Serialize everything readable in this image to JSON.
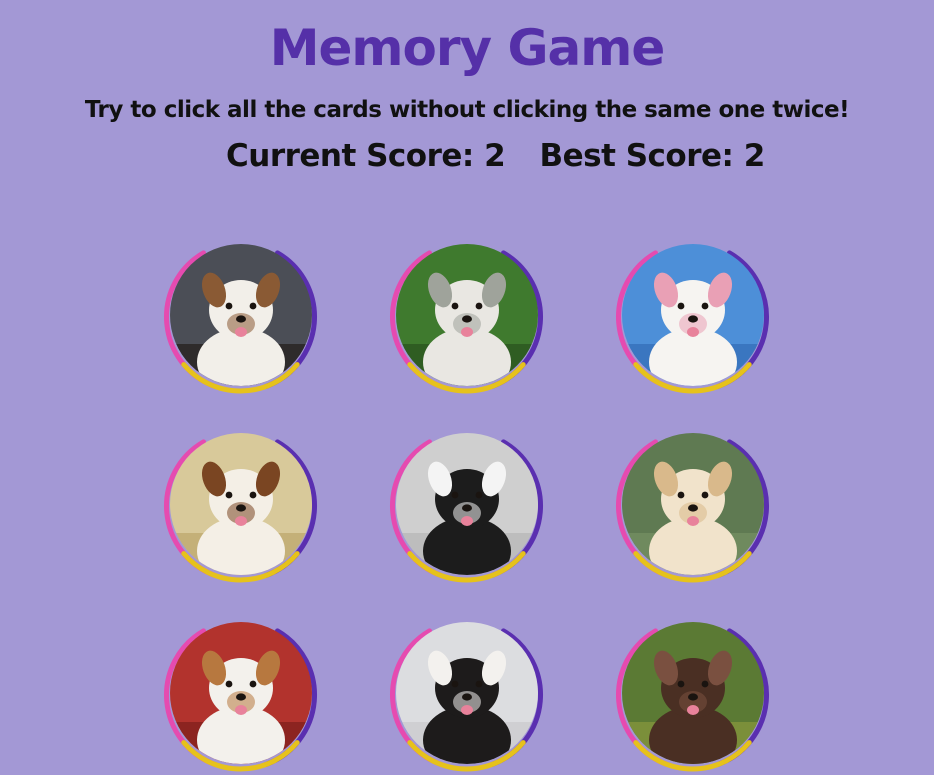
{
  "header": {
    "title": "Memory Game",
    "instructions": "Try to click all the cards without clicking the same one twice!"
  },
  "scoreboard": {
    "current_label": "Current Score: 2",
    "best_label": "Best Score: 2",
    "current_score": 2,
    "best_score": 2
  },
  "ring_colors": {
    "left": "#e54bb0",
    "right": "#5a2fb0",
    "bottom": "#e6c21b"
  },
  "cards": [
    {
      "name": "boxer-bulldog",
      "bg": "#4b4e56",
      "fur": "#f2efe9",
      "accent": "#8a5a34",
      "ground": "#2e2b2b"
    },
    {
      "name": "white-terrier",
      "bg": "#3f7a2e",
      "fur": "#e9e7e2",
      "accent": "#9fa39b",
      "ground": "#2f5d22"
    },
    {
      "name": "white-shepherd",
      "bg": "#4d8fd8",
      "fur": "#f6f4f1",
      "accent": "#e9a0b5",
      "ground": "#3a76c0"
    },
    {
      "name": "papillon",
      "bg": "#d8c99a",
      "fur": "#f4efe6",
      "accent": "#7a4522",
      "ground": "#c4b078"
    },
    {
      "name": "border-collie",
      "bg": "#cfcfcf",
      "fur": "#1c1c1c",
      "accent": "#f4f4f4",
      "ground": "#bdbdbd"
    },
    {
      "name": "golden-retriever",
      "bg": "#5f7a52",
      "fur": "#f1e3cb",
      "accent": "#d9b98b",
      "ground": "#6f8a5e"
    },
    {
      "name": "jack-russell",
      "bg": "#b2332d",
      "fur": "#f3f1ec",
      "accent": "#b7783f",
      "ground": "#8c2420"
    },
    {
      "name": "bernedoodle-puppy",
      "bg": "#dcdde0",
      "fur": "#1d1b1b",
      "accent": "#f3f1ee",
      "ground": "#cfcfd2"
    },
    {
      "name": "pointer",
      "bg": "#5b7a34",
      "fur": "#4a2f23",
      "accent": "#7a5040",
      "ground": "#7b8f3a"
    }
  ]
}
